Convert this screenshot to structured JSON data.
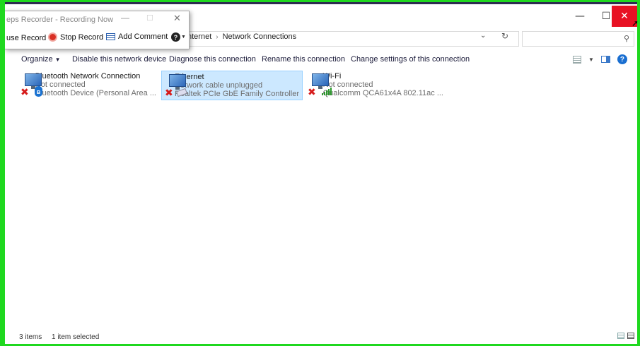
{
  "recorder": {
    "title": "eps Recorder - Recording Now",
    "pause_label": "use Record",
    "stop_label": "Stop Record",
    "comment_label": "Add Comment"
  },
  "window": {
    "minimize_glyph": "—",
    "maximize_glyph": "☐",
    "close_glyph": "✕"
  },
  "address": {
    "crumbs": [
      "nternet",
      "Network Connections"
    ],
    "separator": "›",
    "chevron_glyph": "⌄",
    "refresh_glyph": "↻",
    "search_glyph": "⚲"
  },
  "commands": {
    "organize": "Organize",
    "disable": "Disable this network device",
    "diagnose": "Diagnose this connection",
    "rename": "Rename this connection",
    "change": "Change settings of this connection"
  },
  "connections": [
    {
      "name": "Bluetooth Network Connection",
      "status": "Not connected",
      "device": "Bluetooth Device (Personal Area ...",
      "selected": false
    },
    {
      "name": "Ethernet",
      "status": "Network cable unplugged",
      "device": "Realtek PCIe GbE Family Controller",
      "selected": true
    },
    {
      "name": "Wi-Fi",
      "status": "Not connected",
      "device": "Qualcomm QCA61x4A 802.11ac ...",
      "selected": false
    }
  ],
  "status": {
    "count": "3 items",
    "selection": "1 item selected"
  },
  "colors": {
    "recording_border": "#1fd81f",
    "close_button": "#e81123",
    "selection_bg": "#cce8ff"
  }
}
